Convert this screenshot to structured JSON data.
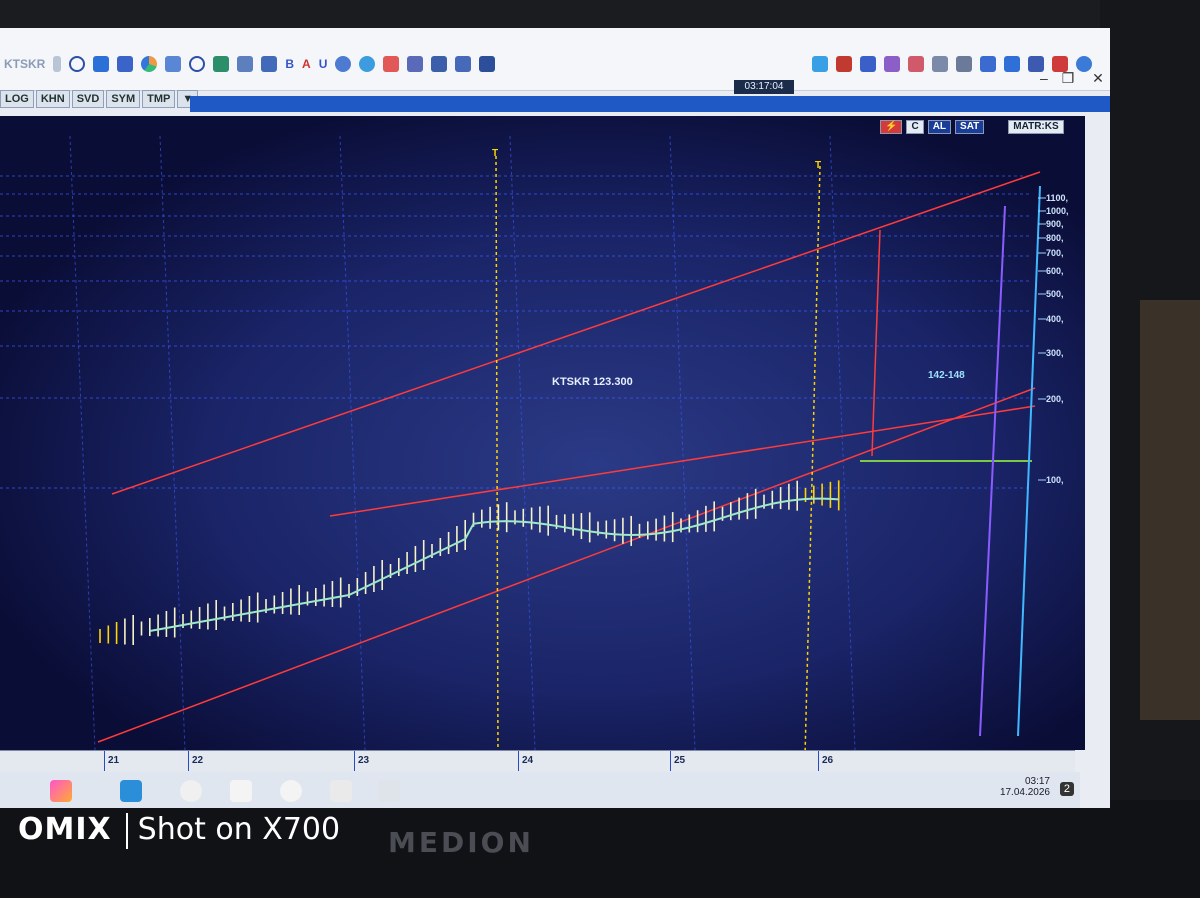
{
  "toolbar": {
    "symbol_field": "KTSKR",
    "clock": "03:17:04",
    "tabs": [
      "LOG",
      "KHN",
      "SVD",
      "SYM",
      "TMP"
    ]
  },
  "chart_header": {
    "buttons": [
      "C",
      "AL",
      "SAT"
    ],
    "title": "MATR:KS"
  },
  "chart": {
    "instrument_label": "KTSKR 123.300",
    "target_label": "142-148",
    "cursor_markers": [
      "T",
      "T"
    ],
    "price_ticks": [
      "1100,",
      "1000,",
      "900,",
      "800,",
      "700,",
      "600,",
      "500,",
      "400,",
      "300,",
      "200,",
      "100,"
    ],
    "date_labels": [
      "21",
      "22",
      "23",
      "24",
      "25",
      "26"
    ],
    "colors": {
      "background": "#0c0f3a",
      "grid": "#3d5cff",
      "trend": "#ff3b3b",
      "ma": "#9fe8c8",
      "bar": "#f6f3c8",
      "highlight": "#ffd400",
      "target_line": "#9bff3a",
      "purple_line": "#8a5cff",
      "cyan_line": "#40b8ff"
    }
  },
  "taskbar": {
    "time": "03:17",
    "date": "17.04.2026",
    "notification_count": "2"
  },
  "photo": {
    "brand": "MEDION",
    "watermark_logo": "OMIX",
    "watermark_text": "Shot on X700"
  }
}
